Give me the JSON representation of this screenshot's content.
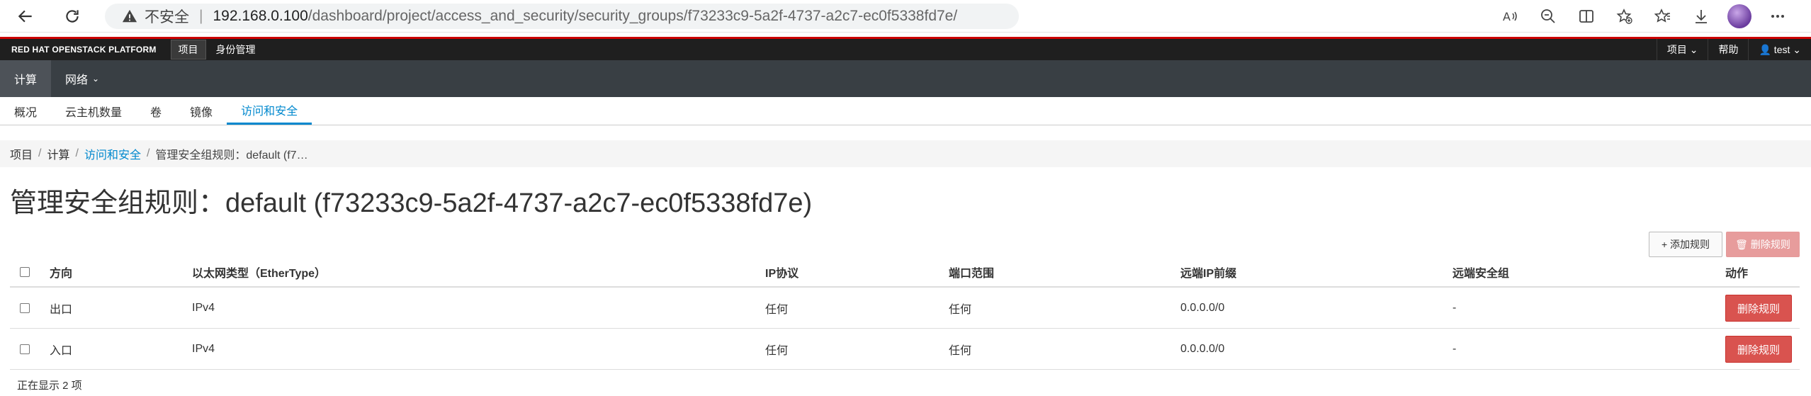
{
  "browser": {
    "insecure_label": "不安全",
    "separator": "|",
    "url_host": "192.168.0.100",
    "url_path": "/dashboard/project/access_and_security/security_groups/f73233c9-5a2f-4737-a2c7-ec0f5338fd7e/"
  },
  "topnav": {
    "brand": "RED HAT OPENSTACK PLATFORM",
    "project": "项目",
    "identity": "身份管理",
    "right_project": "项目 ⌄",
    "help": "帮助",
    "user": "👤 test ⌄"
  },
  "secnav": {
    "compute": "计算",
    "network": "网络"
  },
  "tabs": [
    "概况",
    "云主机数量",
    "卷",
    "镜像",
    "访问和安全"
  ],
  "breadcrumb": {
    "items": [
      "项目",
      "计算",
      "访问和安全"
    ],
    "current": "管理安全组规则：default (f7…"
  },
  "page": {
    "title": "管理安全组规则：default (f73233c9-5a2f-4737-a2c7-ec0f5338fd7e)",
    "add_rule": "+ 添加规则",
    "delete_rules": "🗑 删除规则"
  },
  "table": {
    "headers": [
      "方向",
      "以太网类型（EtherType）",
      "IP协议",
      "端口范围",
      "远端IP前缀",
      "远端安全组",
      "动作"
    ],
    "rows": [
      {
        "direction": "出口",
        "ethertype": "IPv4",
        "protocol": "任何",
        "port": "任何",
        "prefix": "0.0.0.0/0",
        "group": "-",
        "action": "删除规则"
      },
      {
        "direction": "入口",
        "ethertype": "IPv4",
        "protocol": "任何",
        "port": "任何",
        "prefix": "0.0.0.0/0",
        "group": "-",
        "action": "删除规则"
      }
    ],
    "footer": "正在显示 2 项"
  }
}
